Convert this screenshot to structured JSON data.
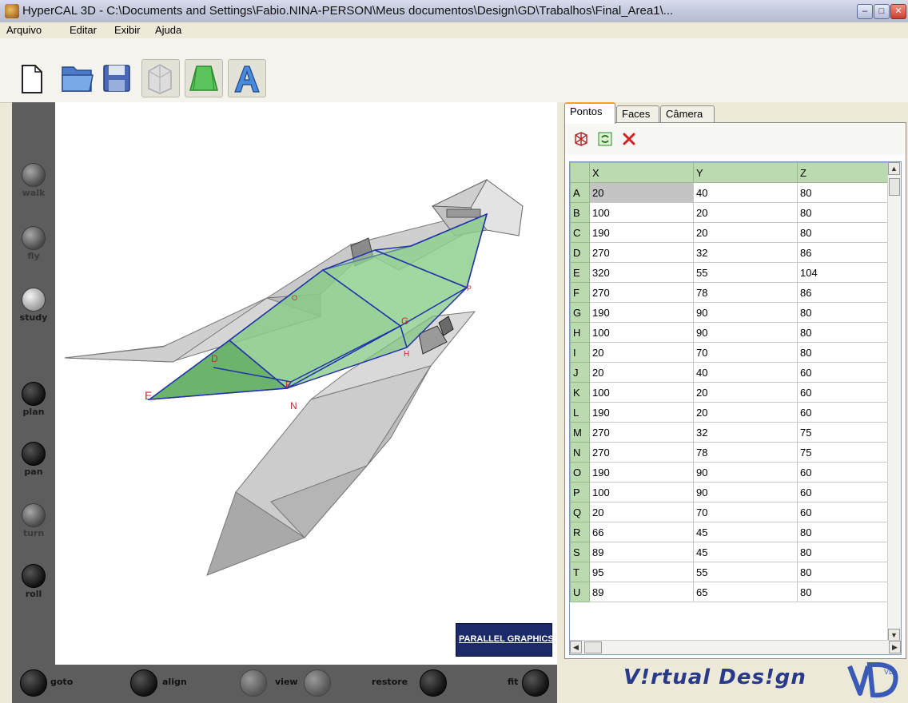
{
  "window": {
    "title": "HyperCAL 3D - C:\\Documents and Settings\\Fabio.NINA-PERSON\\Meus documentos\\Design\\GD\\Trabalhos\\Final_Area1\\...",
    "minimize": "–",
    "maximize": "□",
    "close": "✕"
  },
  "menu": [
    "Arquivo",
    "Editar",
    "Exibir",
    "Ajuda"
  ],
  "toolbar": {
    "buttons": [
      {
        "name": "new-file",
        "icon": "blank-page-icon",
        "toggled": false
      },
      {
        "name": "open-file",
        "icon": "folder-icon",
        "toggled": false
      },
      {
        "name": "save-file",
        "icon": "floppy-disk-icon",
        "toggled": false
      },
      {
        "name": "view-points",
        "icon": "wireframe-icon",
        "toggled": true
      },
      {
        "name": "view-solid",
        "icon": "green-solid-icon",
        "toggled": true
      },
      {
        "name": "view-text",
        "icon": "letter-a-icon",
        "toggled": true
      }
    ]
  },
  "navigation": {
    "side": [
      {
        "label": "walk",
        "state": "disabled"
      },
      {
        "label": "fly",
        "state": "disabled"
      },
      {
        "label": "study",
        "state": "active"
      },
      {
        "label": "plan",
        "state": "enabled"
      },
      {
        "label": "pan",
        "state": "enabled"
      },
      {
        "label": "turn",
        "state": "disabled"
      },
      {
        "label": "roll",
        "state": "enabled"
      }
    ],
    "bottom": [
      {
        "label": "goto",
        "state": "enabled"
      },
      {
        "label": "align",
        "state": "enabled"
      },
      {
        "label": "view",
        "state": "disabled"
      },
      {
        "label": "restore",
        "state": "enabled"
      },
      {
        "label": "fit",
        "state": "enabled"
      }
    ]
  },
  "viewport": {
    "logo": "PARALLEL GRAPHICS",
    "model_labels": [
      "E",
      "D",
      "F",
      "G",
      "H",
      "N",
      "O",
      "P"
    ]
  },
  "tabs": [
    "Pontos",
    "Faces",
    "Câmera"
  ],
  "active_tab": "Pontos",
  "points_table": {
    "columns": [
      "X",
      "Y",
      "Z"
    ],
    "rows": [
      {
        "id": "A",
        "x": "20",
        "y": "40",
        "z": "80"
      },
      {
        "id": "B",
        "x": "100",
        "y": "20",
        "z": "80"
      },
      {
        "id": "C",
        "x": "190",
        "y": "20",
        "z": "80"
      },
      {
        "id": "D",
        "x": "270",
        "y": "32",
        "z": "86"
      },
      {
        "id": "E",
        "x": "320",
        "y": "55",
        "z": "104"
      },
      {
        "id": "F",
        "x": "270",
        "y": "78",
        "z": "86"
      },
      {
        "id": "G",
        "x": "190",
        "y": "90",
        "z": "80"
      },
      {
        "id": "H",
        "x": "100",
        "y": "90",
        "z": "80"
      },
      {
        "id": "I",
        "x": "20",
        "y": "70",
        "z": "80"
      },
      {
        "id": "J",
        "x": "20",
        "y": "40",
        "z": "60"
      },
      {
        "id": "K",
        "x": "100",
        "y": "20",
        "z": "60"
      },
      {
        "id": "L",
        "x": "190",
        "y": "20",
        "z": "60"
      },
      {
        "id": "M",
        "x": "270",
        "y": "32",
        "z": "75"
      },
      {
        "id": "N",
        "x": "270",
        "y": "78",
        "z": "75"
      },
      {
        "id": "O",
        "x": "190",
        "y": "90",
        "z": "60"
      },
      {
        "id": "P",
        "x": "100",
        "y": "90",
        "z": "60"
      },
      {
        "id": "Q",
        "x": "20",
        "y": "70",
        "z": "60"
      },
      {
        "id": "R",
        "x": "66",
        "y": "45",
        "z": "80"
      },
      {
        "id": "S",
        "x": "89",
        "y": "45",
        "z": "80"
      },
      {
        "id": "T",
        "x": "95",
        "y": "55",
        "z": "80"
      },
      {
        "id": "U",
        "x": "89",
        "y": "65",
        "z": "80"
      }
    ]
  },
  "brand": {
    "text": "V!rtual Des!gn",
    "mark": "VD"
  }
}
